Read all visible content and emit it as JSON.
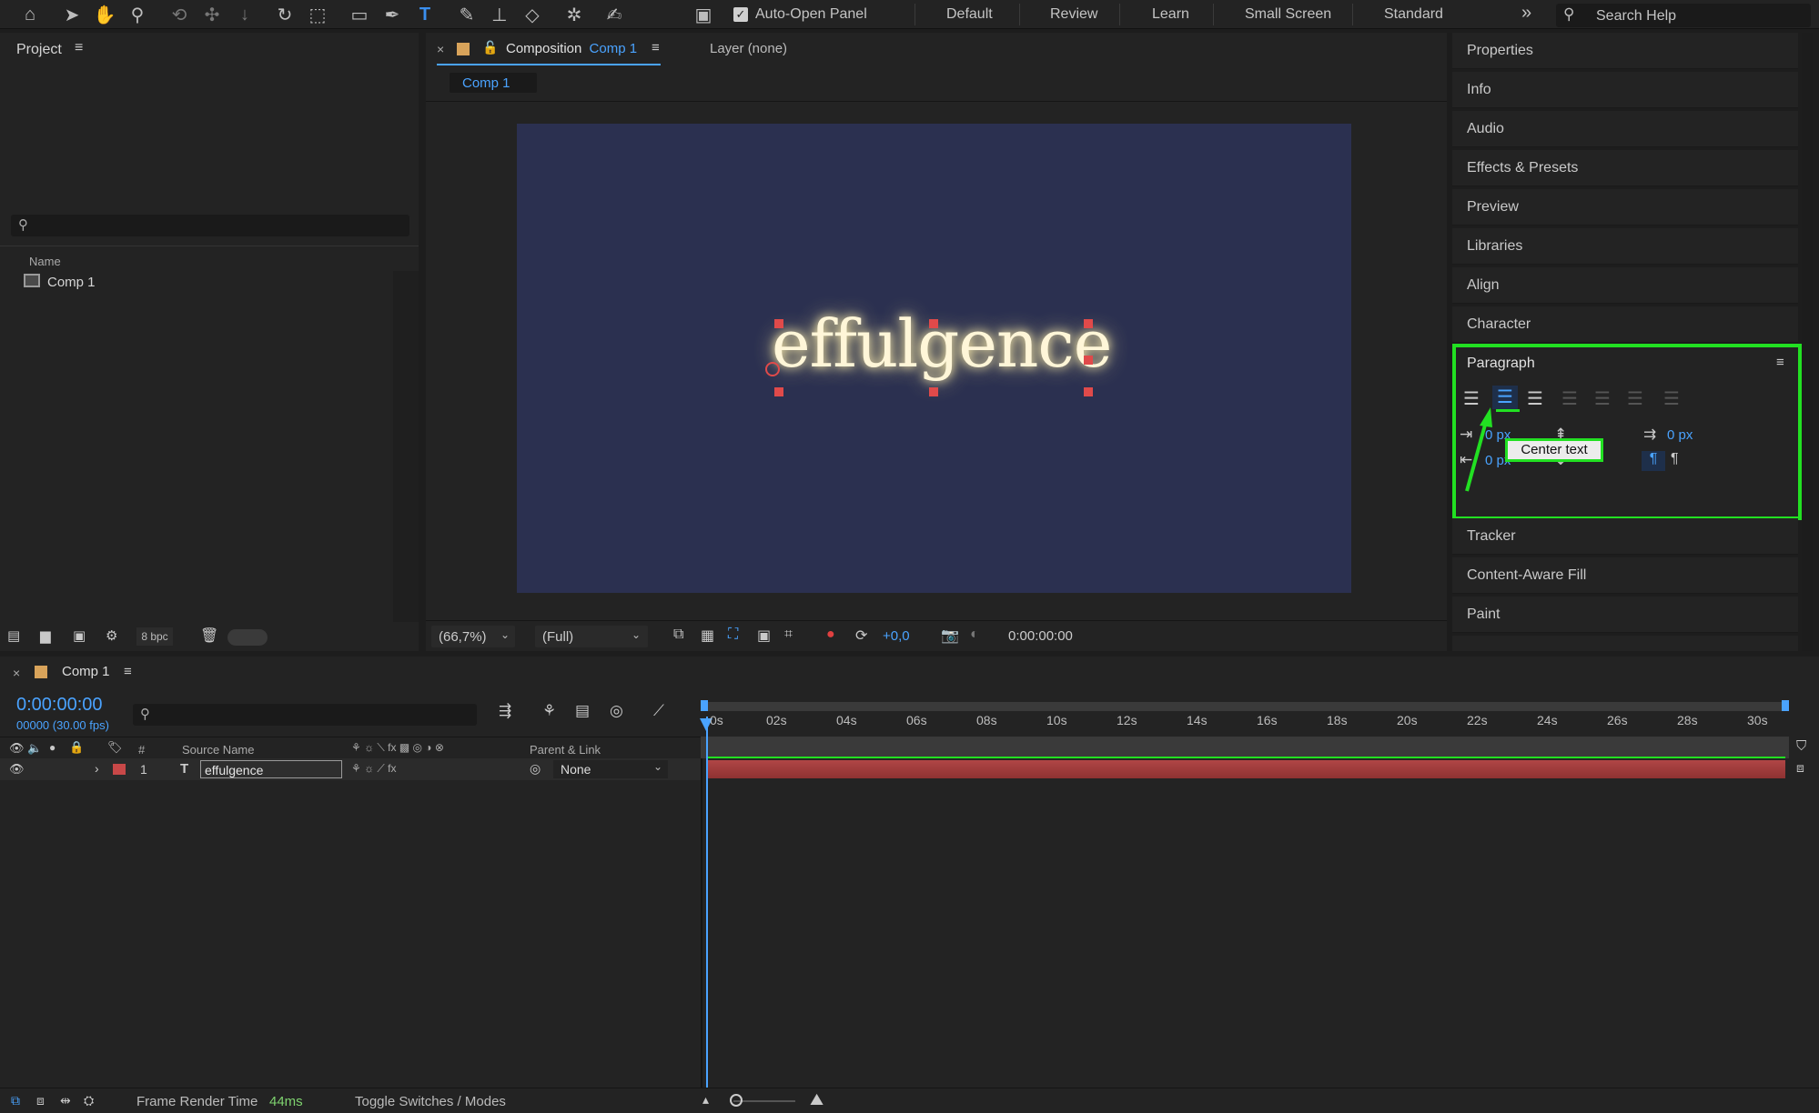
{
  "toolbar": {
    "auto_open_panel": "Auto-Open Panel",
    "workspaces": [
      "Default",
      "Review",
      "Learn",
      "Small Screen",
      "Standard"
    ],
    "search_placeholder": "Search Help"
  },
  "project": {
    "title": "Project",
    "column_name": "Name",
    "items": [
      {
        "label": "Comp 1"
      }
    ],
    "bpc": "8 bpc"
  },
  "composition": {
    "tab_prefix": "Composition",
    "tab_comp": "Comp 1",
    "layer_tab": "Layer (none)",
    "subtab": "Comp 1",
    "canvas_text": "effulgence",
    "zoom": "(66,7%)",
    "resolution": "(Full)",
    "exposure": "+0,0",
    "timecode": "0:00:00:00"
  },
  "right_panels": {
    "items_top": [
      "Properties",
      "Info",
      "Audio",
      "Effects & Presets",
      "Preview",
      "Libraries",
      "Align",
      "Character"
    ],
    "paragraph_title": "Paragraph",
    "indent_values": [
      "0 px",
      "0 px",
      "0 px"
    ],
    "tooltip": "Center text",
    "items_bottom": [
      "Tracker",
      "Content-Aware Fill",
      "Paint"
    ]
  },
  "timeline": {
    "tab": "Comp 1",
    "timecode": "0:00:00:00",
    "fps": "00000 (30.00 fps)",
    "headers": {
      "num": "#",
      "source": "Source Name",
      "parent": "Parent & Link"
    },
    "ticks": [
      "0s",
      "02s",
      "04s",
      "06s",
      "08s",
      "10s",
      "12s",
      "14s",
      "16s",
      "18s",
      "20s",
      "22s",
      "24s",
      "26s",
      "28s",
      "30s"
    ],
    "layer": {
      "index": "1",
      "name": "effulgence",
      "parent": "None"
    }
  },
  "status": {
    "render_label": "Frame Render Time",
    "render_value": "44ms",
    "toggle": "Toggle Switches / Modes"
  },
  "colors": {
    "accent_blue": "#2d8ceb",
    "highlight_green": "#22e022",
    "layer_bar": "#a03a3a"
  }
}
